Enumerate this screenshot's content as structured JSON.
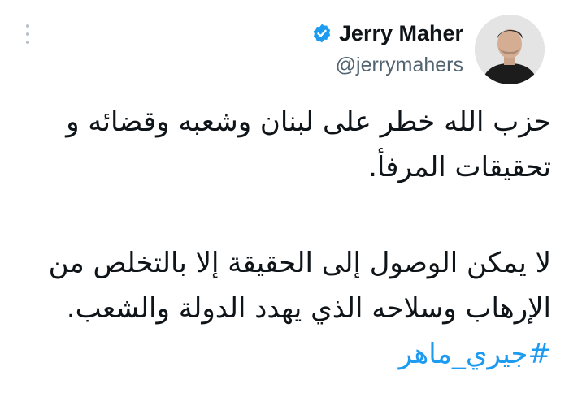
{
  "author": {
    "display_name": "Jerry Maher",
    "handle": "@jerrymahers",
    "verified_icon": "verified-badge-icon",
    "avatar_icon": "avatar"
  },
  "colors": {
    "verified": "#1d9bf0",
    "hashtag": "#1d9bf0",
    "handle": "#536471",
    "text": "#0f1419"
  },
  "tweet": {
    "paragraph1": "حزب الله خطر على لبنان وشعبه وقضائه و تحقيقات المرفأ.",
    "paragraph2_text": "لا يمكن الوصول إلى الحقيقة إلا بالتخلص من الإرهاب وسلاحه الذي يهدد الدولة والشعب. ",
    "hashtag": "#جيري_ماهر"
  },
  "menu_icon": "more-options-icon"
}
